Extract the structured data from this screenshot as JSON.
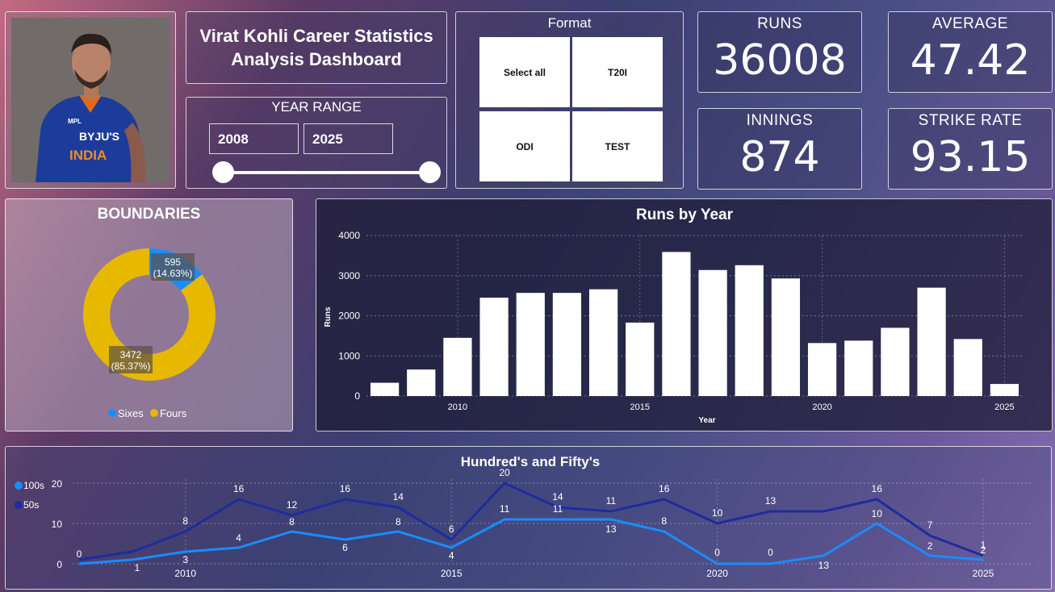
{
  "dashboard": {
    "title_line1": "Virat Kohli Career Statistics",
    "title_line2": "Analysis Dashboard"
  },
  "year_range": {
    "label": "YEAR RANGE",
    "start": "2008",
    "end": "2025"
  },
  "format": {
    "label": "Format",
    "options": [
      "Select all",
      "T20I",
      "ODI",
      "TEST"
    ]
  },
  "kpis": {
    "runs_label": "RUNS",
    "runs_value": "36008",
    "average_label": "AVERAGE",
    "average_value": "47.42",
    "innings_label": "INNINGS",
    "innings_value": "874",
    "strike_label": "STRIKE RATE",
    "strike_value": "93.15"
  },
  "photo": {
    "shirt_text_1": "BYJU'S",
    "shirt_text_2": "INDIA",
    "shirt_text_3": "MPL"
  },
  "chart_data": [
    {
      "type": "pie",
      "title": "BOUNDARIES",
      "slices": [
        {
          "name": "Sixes",
          "value": 595,
          "label": "595",
          "pct_label": "(14.63%)",
          "color": "#1a8cff"
        },
        {
          "name": "Fours",
          "value": 3472,
          "label": "3472",
          "pct_label": "(85.37%)",
          "color": "#e6b800"
        }
      ]
    },
    {
      "type": "bar",
      "title": "Runs by Year",
      "xlabel": "Year",
      "ylabel": "Runs",
      "ylim": [
        0,
        4000
      ],
      "yticks": [
        "0",
        "1000",
        "2000",
        "3000",
        "4000"
      ],
      "xticks": [
        "2010",
        "2015",
        "2020",
        "2025"
      ],
      "x": [
        2008,
        2009,
        2010,
        2011,
        2012,
        2013,
        2014,
        2015,
        2016,
        2017,
        2018,
        2019,
        2020,
        2021,
        2022,
        2023,
        2024,
        2025
      ],
      "values": [
        330,
        660,
        1450,
        2450,
        2570,
        2570,
        2660,
        1830,
        3590,
        3140,
        3260,
        2930,
        1320,
        1380,
        1700,
        2700,
        1420,
        300
      ],
      "color": "#ffffff"
    },
    {
      "type": "line",
      "title": "Hundred's and Fifty's",
      "ylim": [
        0,
        20
      ],
      "yticks": [
        "0",
        "10",
        "20"
      ],
      "xticks": [
        "2010",
        "2015",
        "2020",
        "2025"
      ],
      "x": [
        2008,
        2009,
        2010,
        2011,
        2012,
        2013,
        2014,
        2015,
        2016,
        2017,
        2018,
        2019,
        2020,
        2021,
        2022,
        2023,
        2024,
        2025
      ],
      "series": [
        {
          "name": "100s",
          "color": "#1a8cff",
          "values": [
            0,
            1,
            3,
            4,
            8,
            6,
            8,
            4,
            11,
            11,
            11,
            8,
            0,
            0,
            2,
            10,
            2,
            1
          ]
        },
        {
          "name": "50s",
          "color": "#1f2b9e",
          "values": [
            1,
            3,
            8,
            16,
            12,
            16,
            14,
            6,
            20,
            14,
            13,
            16,
            10,
            13,
            13,
            16,
            7,
            2
          ]
        }
      ],
      "labels_100s": [
        "0",
        "1",
        "3",
        "4",
        "8",
        "6",
        "8",
        "4",
        "11",
        "11",
        "13",
        "8",
        "0",
        "0",
        "13",
        "10",
        "2",
        "2"
      ],
      "labels_50s": [
        "",
        "",
        "8",
        "16",
        "12",
        "16",
        "14",
        "6",
        "20",
        "14",
        "11",
        "16",
        "10",
        "13",
        "",
        "16",
        "7",
        "1"
      ]
    }
  ]
}
